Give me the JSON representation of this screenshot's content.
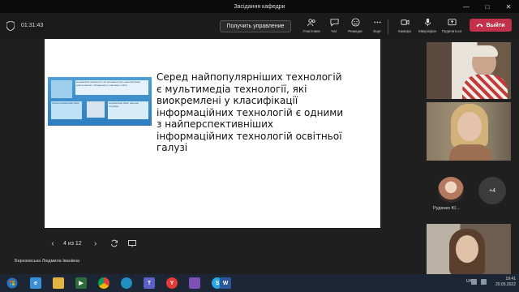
{
  "window": {
    "title": "Засідання кафедри"
  },
  "toolbar": {
    "timer": "01:31:43",
    "control_label": "Получить управление",
    "participants": "Участники",
    "chat": "Чат",
    "reactions": "Реакции",
    "more": "Еще",
    "camera": "Камера",
    "mic": "Микрофон",
    "share": "Поделиться",
    "leave": "Выйти"
  },
  "slide": {
    "banner_text_1": "Нормативні документи, які регламентують використання комп'ютерного обладнання у закладах освіти",
    "banner_text_2": "Чинна нормативна база",
    "banner_text_3": "Нормативна база, яка нам потрібна",
    "text": "Серед найпопулярніших технологій є мультимедіа технології, які виокремлені у класифікації інформаційних технологій є одними з найперспективніших інформаційних технологій освітньої галузі"
  },
  "nav": {
    "page": "4 из 12"
  },
  "presenter": "Березовська Людмила Іванівна",
  "participants": {
    "avatar_name": "Руденко Ю...",
    "overflow": "+4"
  },
  "taskbar": {
    "language": "UK",
    "time": "19:41",
    "date": "20.05.2022"
  },
  "colors": {
    "leave": "#c4314b",
    "accent": "#6264a7"
  }
}
